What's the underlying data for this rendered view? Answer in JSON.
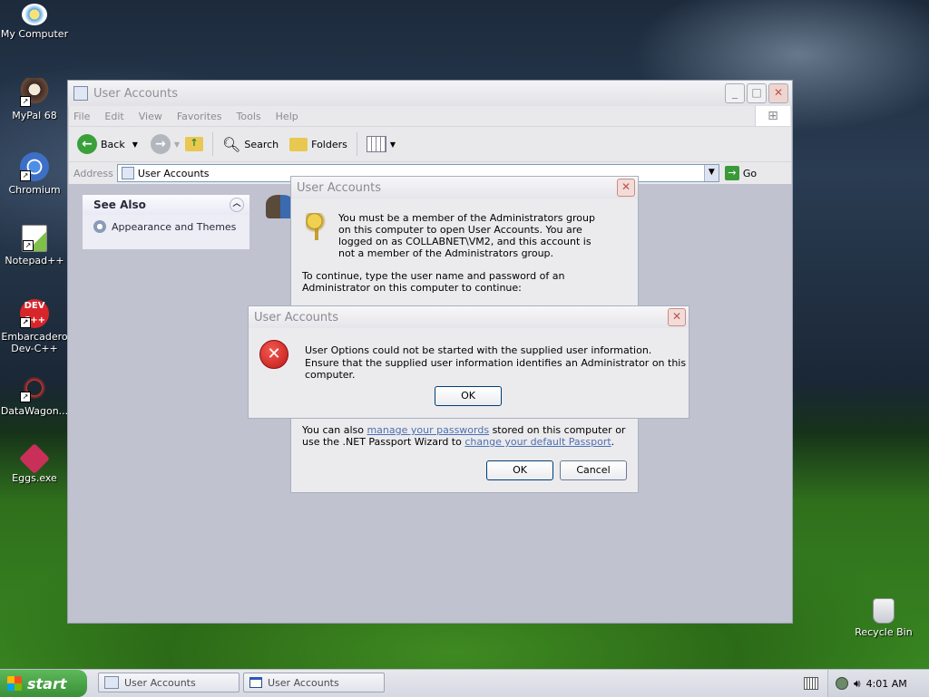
{
  "desktop": {
    "icons": [
      {
        "label": "My Computer"
      },
      {
        "label": "MyPal 68"
      },
      {
        "label": "Chromium"
      },
      {
        "label": "Notepad++"
      },
      {
        "label": "Embarcadero Dev-C++"
      },
      {
        "label": "DataWagon..."
      },
      {
        "label": "Eggs.exe"
      },
      {
        "label": "Recycle Bin"
      }
    ]
  },
  "explorer": {
    "title": "User Accounts",
    "menu": [
      "File",
      "Edit",
      "View",
      "Favorites",
      "Tools",
      "Help"
    ],
    "toolbar": {
      "back": "Back",
      "search": "Search",
      "folders": "Folders"
    },
    "address": {
      "label": "Address",
      "value": "User Accounts",
      "go": "Go"
    },
    "see_also": {
      "title": "See Also",
      "items": [
        "Appearance and Themes"
      ]
    }
  },
  "dialog_admin": {
    "title": "User Accounts",
    "message": "You must be a member of the Administrators group on this computer to open User Accounts.  You are logged on as COLLABNET\\VM2, and this account is not a member of the Administrators group.",
    "continue_text": "To continue, type the user name and password of an Administrator on this computer to continue:",
    "footer_prefix": "You can also ",
    "link1": "manage your passwords",
    "footer_mid": " stored on this computer or use the .NET Passport Wizard to ",
    "link2": "change your default Passport",
    "footer_end": ".",
    "ok": "OK",
    "cancel": "Cancel"
  },
  "dialog_error": {
    "title": "User Accounts",
    "line1": "User Options could not be started with the supplied user information.",
    "line2": "Ensure that the supplied user information identifies an Administrator on this computer.",
    "ok": "OK"
  },
  "taskbar": {
    "start": "start",
    "tasks": [
      "User Accounts",
      "User Accounts"
    ],
    "clock": "4:01 AM"
  }
}
